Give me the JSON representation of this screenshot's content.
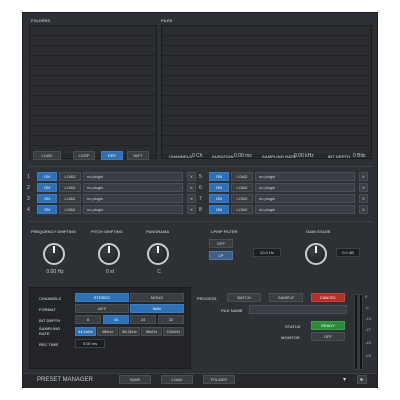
{
  "browser": {
    "folders_title": "FOLDERS",
    "files_title": "FILES"
  },
  "transport": {
    "load": "LOAD",
    "loop": "LOOP",
    "dry": "DRY",
    "wet": "WET",
    "channels_label": "CHANNELS",
    "channels_value": "0 Ch",
    "duration_label": "DURATION",
    "duration_value": "0.00 ms",
    "sampling_label": "SAMPLING RATE",
    "sampling_value": "0.00 kHz",
    "bitdepth_label": "BIT DEPTH",
    "bitdepth_value": "0 Bits"
  },
  "slots": [
    {
      "num": "1",
      "on": "ON",
      "load": "LOAD",
      "plugin": "no plugin",
      "close": "X"
    },
    {
      "num": "2",
      "on": "ON",
      "load": "LOAD",
      "plugin": "no plugin",
      "close": "X"
    },
    {
      "num": "3",
      "on": "ON",
      "load": "LOAD",
      "plugin": "no plugin",
      "close": "X"
    },
    {
      "num": "4",
      "on": "ON",
      "load": "LOAD",
      "plugin": "no plugin",
      "close": "X"
    },
    {
      "num": "5",
      "on": "ON",
      "load": "LOAD",
      "plugin": "no plugin",
      "close": "X"
    },
    {
      "num": "6",
      "on": "ON",
      "load": "LOAD",
      "plugin": "no plugin",
      "close": "X"
    },
    {
      "num": "7",
      "on": "ON",
      "load": "LOAD",
      "plugin": "no plugin",
      "close": "X"
    },
    {
      "num": "8",
      "on": "ON",
      "load": "LOAD",
      "plugin": "no plugin",
      "close": "X"
    }
  ],
  "effects": {
    "freq_label": "FREQUENCY SHIFTING",
    "freq_value": "0.00 Hz",
    "pitch_label": "PITCH SHIFTING",
    "pitch_value": "0 st",
    "pan_label": "PANORAMA",
    "pan_value": "C",
    "filter_label": "LP/HP FILTER",
    "filter_off": "OFF",
    "filter_lp": "LP",
    "filter_value": "20.0 Hz",
    "gain_label": "GAIN STAGE",
    "gain_value": "0.0 dB"
  },
  "format": {
    "channels_label": "CHANNELS",
    "stereo": "STEREO",
    "mono": "MONO",
    "format_label": "FORMAT",
    "aiff": "AIFF",
    "wav": "WAV",
    "bitdepth_label": "BIT DEPTH",
    "bd": [
      "8",
      "16",
      "24",
      "32"
    ],
    "sampling_label": "SAMPLING RATE",
    "sr": [
      "44.1kHz",
      "48kHz",
      "88.2kHz",
      "96kHz",
      "192kHz"
    ],
    "rectime_label": "REC TIME",
    "rectime_value": "0.00 ms"
  },
  "process": {
    "label": "PROCESS",
    "batch": "BATCH",
    "sample": "SAMPLE",
    "cancel": "CANCEL",
    "filename_label": "FILE NAME",
    "filename_value": "",
    "status_label": "STATUS",
    "status_value": "READY",
    "monitor_label": "MONITOR",
    "monitor_value": "OFF"
  },
  "meter": {
    "scale": [
      "0",
      "-6",
      "-15",
      "-27",
      "-45",
      "-60"
    ]
  },
  "preset": {
    "title": "PRESET MANAGER",
    "save": "SAVE",
    "load": "LOAD",
    "folder": "FOLDER",
    "dropdown": "▾",
    "next": "▸"
  }
}
